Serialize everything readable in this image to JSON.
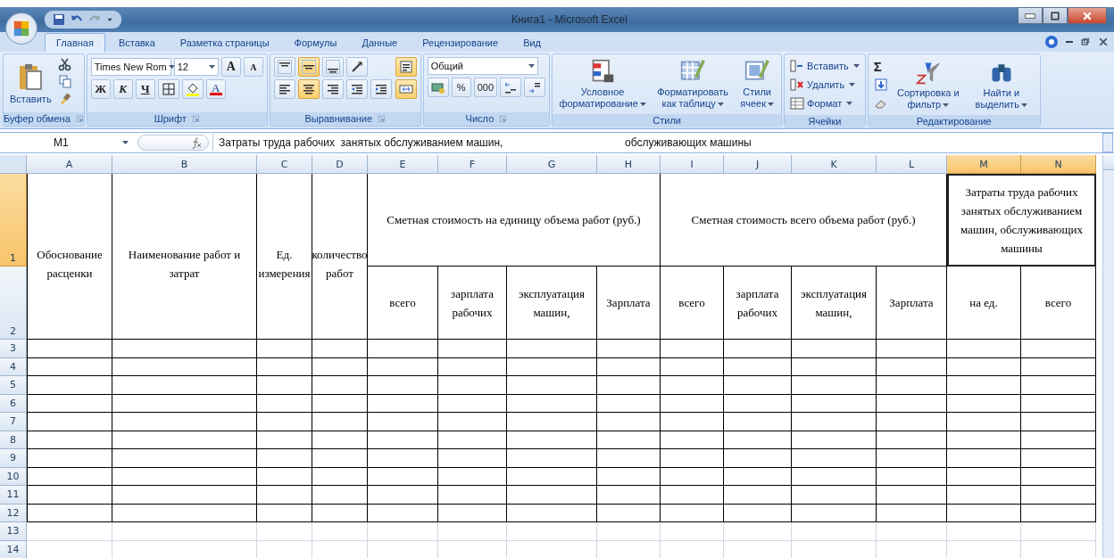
{
  "window": {
    "title": "Книга1 - Microsoft Excel"
  },
  "tabs": [
    {
      "label": "Главная",
      "selected": true
    },
    {
      "label": "Вставка",
      "selected": false
    },
    {
      "label": "Разметка страницы",
      "selected": false
    },
    {
      "label": "Формулы",
      "selected": false
    },
    {
      "label": "Данные",
      "selected": false
    },
    {
      "label": "Рецензирование",
      "selected": false
    },
    {
      "label": "Вид",
      "selected": false
    }
  ],
  "ribbon": [
    {
      "kind": "clipboard",
      "label": "Буфер обмена",
      "paste": "Вставить"
    },
    {
      "kind": "font",
      "label": "Шрифт",
      "font": "Times New Rom",
      "size": "12",
      "grow": "A",
      "shrink": "A",
      "bold": "Ж",
      "italic": "К",
      "underline": "Ч",
      "font_color": "A"
    },
    {
      "kind": "alignment",
      "label": "Выравнивание",
      "top": [
        {
          "on": false
        },
        {
          "on": true
        },
        {
          "on": false
        }
      ],
      "wrap_on": true,
      "bottom": [
        {
          "on": false
        },
        {
          "on": true
        },
        {
          "on": false
        }
      ],
      "merge_on": true
    },
    {
      "kind": "number",
      "label": "Число",
      "format": "Общий",
      "percent": "%",
      "thousands": "000"
    },
    {
      "kind": "styles",
      "label": "Стили",
      "buttons": [
        "Условное форматирование",
        "Форматировать как таблицу",
        "Стили ячеек"
      ]
    },
    {
      "kind": "cells",
      "label": "Ячейки",
      "buttons": [
        "Вставить",
        "Удалить",
        "Формат"
      ]
    },
    {
      "kind": "editing",
      "label": "Редактирование",
      "sum": "Σ",
      "buttons": [
        "Сортировка и фильтр",
        "Найти и выделить"
      ]
    }
  ],
  "name_box": "M1",
  "formula": "Затраты труда рабочих  занятых обслуживанием машин,                                         обслуживающих машины",
  "columns": [
    {
      "label": "A",
      "selected": false
    },
    {
      "label": "B",
      "selected": false
    },
    {
      "label": "C",
      "selected": false
    },
    {
      "label": "D",
      "selected": false
    },
    {
      "label": "E",
      "selected": false
    },
    {
      "label": "F",
      "selected": false
    },
    {
      "label": "G",
      "selected": false
    },
    {
      "label": "H",
      "selected": false
    },
    {
      "label": "I",
      "selected": false
    },
    {
      "label": "J",
      "selected": false
    },
    {
      "label": "K",
      "selected": false
    },
    {
      "label": "L",
      "selected": false
    },
    {
      "label": "M",
      "selected": true
    },
    {
      "label": "N",
      "selected": true
    }
  ],
  "rows": [
    {
      "label": "1",
      "selected": true
    },
    {
      "label": "2",
      "selected": false
    },
    {
      "label": "3",
      "selected": false,
      "bordered": true
    },
    {
      "label": "4",
      "selected": false,
      "bordered": true
    },
    {
      "label": "5",
      "selected": false,
      "bordered": true
    },
    {
      "label": "6",
      "selected": false,
      "bordered": true
    },
    {
      "label": "7",
      "selected": false,
      "bordered": true
    },
    {
      "label": "8",
      "selected": false,
      "bordered": true
    },
    {
      "label": "9",
      "selected": false,
      "bordered": true
    },
    {
      "label": "10",
      "selected": false,
      "bordered": true
    },
    {
      "label": "11",
      "selected": false,
      "bordered": true
    },
    {
      "label": "12",
      "selected": false,
      "bordered": true
    },
    {
      "label": "13",
      "selected": false,
      "bordered": false
    },
    {
      "label": "14",
      "selected": false,
      "bordered": false
    }
  ],
  "header": [
    {
      "kind": "single",
      "text": "Обоснование расценки"
    },
    {
      "kind": "single",
      "text": "Наименование работ и затрат"
    },
    {
      "kind": "single",
      "text": "Ед. измерения"
    },
    {
      "kind": "single",
      "text": "количество работ"
    },
    {
      "kind": "group",
      "text": "Сметная стоимость на единицу объема работ (руб.)",
      "selected": false,
      "subcolumns": [
        "всего",
        "зарплата рабочих",
        "эксплуатация машин,",
        "Зарплата"
      ]
    },
    {
      "kind": "group",
      "text": "Сметная стоимость всего объема работ (руб.)",
      "selected": false,
      "subcolumns": [
        "всего",
        "зарплата рабочих",
        "эксплуатация машин,",
        "Зарплата"
      ]
    },
    {
      "kind": "group",
      "text": "Затраты труда рабочих занятых обслуживанием машин, обслуживающих машины",
      "selected": true,
      "subcolumns": [
        "на ед.",
        "всего"
      ]
    }
  ]
}
